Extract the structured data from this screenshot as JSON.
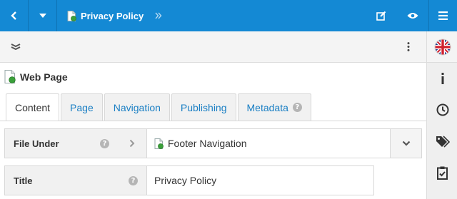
{
  "breadcrumb": {
    "page_title": "Privacy Policy"
  },
  "heading": {
    "title": "Web Page"
  },
  "tabs": [
    {
      "label": "Content"
    },
    {
      "label": "Page"
    },
    {
      "label": "Navigation"
    },
    {
      "label": "Publishing"
    },
    {
      "label": "Metadata"
    }
  ],
  "fields": {
    "file_under": {
      "label": "File Under",
      "value": "Footer Navigation"
    },
    "title": {
      "label": "Title",
      "value": "Privacy Policy"
    }
  },
  "colors": {
    "topbar": "#1489d4",
    "link": "#1a7fc4"
  },
  "icons": [
    "back-icon",
    "caret-down-icon",
    "page-icon",
    "chevron-double-right-icon",
    "edit-icon",
    "eye-icon",
    "hamburger-icon",
    "stack-icon",
    "more-vertical-icon",
    "uk-flag-icon",
    "info-icon",
    "clock-icon",
    "tags-icon",
    "clipboard-check-icon",
    "help-icon",
    "chevron-right-icon",
    "chevron-down-icon"
  ]
}
